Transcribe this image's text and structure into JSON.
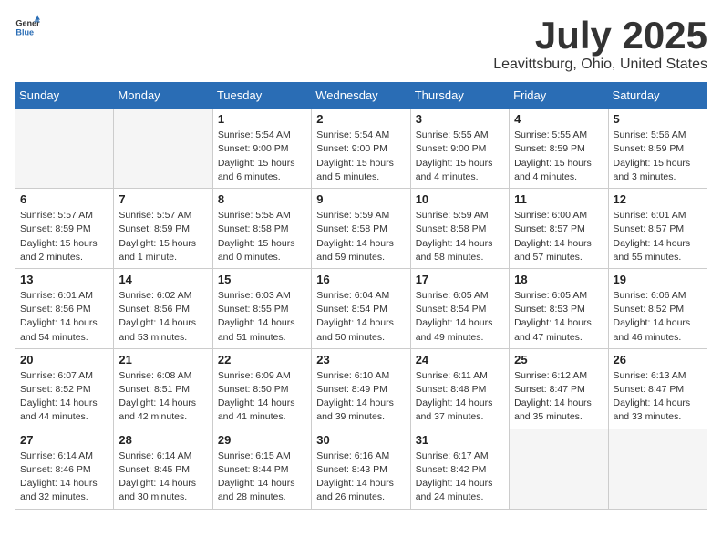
{
  "header": {
    "logo_general": "General",
    "logo_blue": "Blue",
    "month_year": "July 2025",
    "location": "Leavittsburg, Ohio, United States"
  },
  "days_of_week": [
    "Sunday",
    "Monday",
    "Tuesday",
    "Wednesday",
    "Thursday",
    "Friday",
    "Saturday"
  ],
  "weeks": [
    [
      {
        "day": "",
        "empty": true
      },
      {
        "day": "",
        "empty": true
      },
      {
        "day": "1",
        "sunrise": "5:54 AM",
        "sunset": "9:00 PM",
        "daylight": "15 hours and 6 minutes."
      },
      {
        "day": "2",
        "sunrise": "5:54 AM",
        "sunset": "9:00 PM",
        "daylight": "15 hours and 5 minutes."
      },
      {
        "day": "3",
        "sunrise": "5:55 AM",
        "sunset": "9:00 PM",
        "daylight": "15 hours and 4 minutes."
      },
      {
        "day": "4",
        "sunrise": "5:55 AM",
        "sunset": "8:59 PM",
        "daylight": "15 hours and 4 minutes."
      },
      {
        "day": "5",
        "sunrise": "5:56 AM",
        "sunset": "8:59 PM",
        "daylight": "15 hours and 3 minutes."
      }
    ],
    [
      {
        "day": "6",
        "sunrise": "5:57 AM",
        "sunset": "8:59 PM",
        "daylight": "15 hours and 2 minutes."
      },
      {
        "day": "7",
        "sunrise": "5:57 AM",
        "sunset": "8:59 PM",
        "daylight": "15 hours and 1 minute."
      },
      {
        "day": "8",
        "sunrise": "5:58 AM",
        "sunset": "8:58 PM",
        "daylight": "15 hours and 0 minutes."
      },
      {
        "day": "9",
        "sunrise": "5:59 AM",
        "sunset": "8:58 PM",
        "daylight": "14 hours and 59 minutes."
      },
      {
        "day": "10",
        "sunrise": "5:59 AM",
        "sunset": "8:58 PM",
        "daylight": "14 hours and 58 minutes."
      },
      {
        "day": "11",
        "sunrise": "6:00 AM",
        "sunset": "8:57 PM",
        "daylight": "14 hours and 57 minutes."
      },
      {
        "day": "12",
        "sunrise": "6:01 AM",
        "sunset": "8:57 PM",
        "daylight": "14 hours and 55 minutes."
      }
    ],
    [
      {
        "day": "13",
        "sunrise": "6:01 AM",
        "sunset": "8:56 PM",
        "daylight": "14 hours and 54 minutes."
      },
      {
        "day": "14",
        "sunrise": "6:02 AM",
        "sunset": "8:56 PM",
        "daylight": "14 hours and 53 minutes."
      },
      {
        "day": "15",
        "sunrise": "6:03 AM",
        "sunset": "8:55 PM",
        "daylight": "14 hours and 51 minutes."
      },
      {
        "day": "16",
        "sunrise": "6:04 AM",
        "sunset": "8:54 PM",
        "daylight": "14 hours and 50 minutes."
      },
      {
        "day": "17",
        "sunrise": "6:05 AM",
        "sunset": "8:54 PM",
        "daylight": "14 hours and 49 minutes."
      },
      {
        "day": "18",
        "sunrise": "6:05 AM",
        "sunset": "8:53 PM",
        "daylight": "14 hours and 47 minutes."
      },
      {
        "day": "19",
        "sunrise": "6:06 AM",
        "sunset": "8:52 PM",
        "daylight": "14 hours and 46 minutes."
      }
    ],
    [
      {
        "day": "20",
        "sunrise": "6:07 AM",
        "sunset": "8:52 PM",
        "daylight": "14 hours and 44 minutes."
      },
      {
        "day": "21",
        "sunrise": "6:08 AM",
        "sunset": "8:51 PM",
        "daylight": "14 hours and 42 minutes."
      },
      {
        "day": "22",
        "sunrise": "6:09 AM",
        "sunset": "8:50 PM",
        "daylight": "14 hours and 41 minutes."
      },
      {
        "day": "23",
        "sunrise": "6:10 AM",
        "sunset": "8:49 PM",
        "daylight": "14 hours and 39 minutes."
      },
      {
        "day": "24",
        "sunrise": "6:11 AM",
        "sunset": "8:48 PM",
        "daylight": "14 hours and 37 minutes."
      },
      {
        "day": "25",
        "sunrise": "6:12 AM",
        "sunset": "8:47 PM",
        "daylight": "14 hours and 35 minutes."
      },
      {
        "day": "26",
        "sunrise": "6:13 AM",
        "sunset": "8:47 PM",
        "daylight": "14 hours and 33 minutes."
      }
    ],
    [
      {
        "day": "27",
        "sunrise": "6:14 AM",
        "sunset": "8:46 PM",
        "daylight": "14 hours and 32 minutes."
      },
      {
        "day": "28",
        "sunrise": "6:14 AM",
        "sunset": "8:45 PM",
        "daylight": "14 hours and 30 minutes."
      },
      {
        "day": "29",
        "sunrise": "6:15 AM",
        "sunset": "8:44 PM",
        "daylight": "14 hours and 28 minutes."
      },
      {
        "day": "30",
        "sunrise": "6:16 AM",
        "sunset": "8:43 PM",
        "daylight": "14 hours and 26 minutes."
      },
      {
        "day": "31",
        "sunrise": "6:17 AM",
        "sunset": "8:42 PM",
        "daylight": "14 hours and 24 minutes."
      },
      {
        "day": "",
        "empty": true
      },
      {
        "day": "",
        "empty": true
      }
    ]
  ]
}
